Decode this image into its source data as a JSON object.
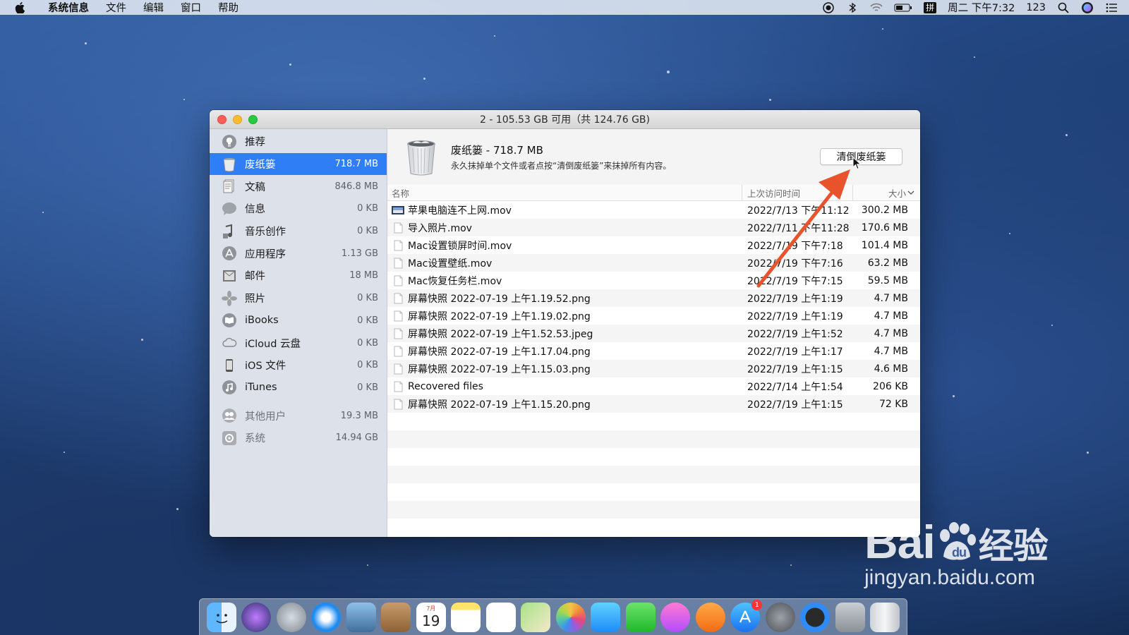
{
  "menubar": {
    "app_name": "系统信息",
    "menus": [
      "文件",
      "编辑",
      "窗口",
      "帮助"
    ],
    "clock": "周二 下午7:32",
    "ime_label": "拼",
    "user_num": "123"
  },
  "window": {
    "title": "2 - 105.53 GB 可用（共 124.76 GB)"
  },
  "sidebar": {
    "items": [
      {
        "label": "推荐",
        "size": "",
        "icon": "recommend-icon"
      },
      {
        "label": "废纸篓",
        "size": "718.7 MB",
        "icon": "trash-icon",
        "selected": true
      },
      {
        "label": "文稿",
        "size": "846.8 MB",
        "icon": "documents-icon"
      },
      {
        "label": "信息",
        "size": "0 KB",
        "icon": "messages-icon"
      },
      {
        "label": "音乐创作",
        "size": "0 KB",
        "icon": "music-creation-icon"
      },
      {
        "label": "应用程序",
        "size": "1.13 GB",
        "icon": "applications-icon"
      },
      {
        "label": "邮件",
        "size": "18 MB",
        "icon": "mail-icon"
      },
      {
        "label": "照片",
        "size": "0 KB",
        "icon": "photos-icon"
      },
      {
        "label": "iBooks",
        "size": "0 KB",
        "icon": "ibooks-icon"
      },
      {
        "label": "iCloud 云盘",
        "size": "0 KB",
        "icon": "icloud-icon"
      },
      {
        "label": "iOS 文件",
        "size": "0 KB",
        "icon": "ios-files-icon"
      },
      {
        "label": "iTunes",
        "size": "0 KB",
        "icon": "itunes-icon"
      }
    ],
    "other_items": [
      {
        "label": "其他用户",
        "size": "19.3 MB",
        "icon": "other-users-icon"
      },
      {
        "label": "系统",
        "size": "14.94 GB",
        "icon": "system-icon"
      }
    ]
  },
  "header": {
    "title": "废纸篓 - 718.7 MB",
    "description": "永久抹掉单个文件或者点按“清倒废纸篓”来抹掉所有内容。",
    "empty_button": "清倒废纸篓"
  },
  "table": {
    "columns": {
      "name": "名称",
      "date": "上次访问时间",
      "size": "大小"
    },
    "rows": [
      {
        "name": "苹果电脑连不上网.mov",
        "date": "2022/7/13 下午11:12",
        "size": "300.2 MB",
        "icon": "video-thumbnail-icon"
      },
      {
        "name": "导入照片.mov",
        "date": "2022/7/11 下午11:28",
        "size": "170.6 MB",
        "icon": "file-icon"
      },
      {
        "name": "Mac设置锁屏时间.mov",
        "date": "2022/7/19 下午7:18",
        "size": "101.4 MB",
        "icon": "file-icon"
      },
      {
        "name": "Mac设置壁纸.mov",
        "date": "2022/7/19 下午7:16",
        "size": "63.2 MB",
        "icon": "file-icon"
      },
      {
        "name": "Mac恢复任务栏.mov",
        "date": "2022/7/19 下午7:15",
        "size": "59.5 MB",
        "icon": "file-icon"
      },
      {
        "name": "屏幕快照 2022-07-19 上午1.19.52.png",
        "date": "2022/7/19 上午1:19",
        "size": "4.7 MB",
        "icon": "file-icon"
      },
      {
        "name": "屏幕快照 2022-07-19 上午1.19.02.png",
        "date": "2022/7/19 上午1:19",
        "size": "4.7 MB",
        "icon": "file-icon"
      },
      {
        "name": "屏幕快照 2022-07-19 上午1.52.53.jpeg",
        "date": "2022/7/19 上午1:52",
        "size": "4.7 MB",
        "icon": "file-icon"
      },
      {
        "name": "屏幕快照 2022-07-19 上午1.17.04.png",
        "date": "2022/7/19 上午1:17",
        "size": "4.7 MB",
        "icon": "file-icon"
      },
      {
        "name": "屏幕快照 2022-07-19 上午1.15.03.png",
        "date": "2022/7/19 上午1:15",
        "size": "4.6 MB",
        "icon": "file-icon"
      },
      {
        "name": "Recovered files",
        "date": "2022/7/14 上午1:54",
        "size": "206 KB",
        "icon": "file-icon"
      },
      {
        "name": "屏幕快照 2022-07-19 上午1.15.20.png",
        "date": "2022/7/19 上午1:15",
        "size": "72 KB",
        "icon": "file-icon"
      }
    ]
  },
  "dock": {
    "calendar_month": "7月",
    "calendar_day": "19",
    "appstore_badge": "1",
    "items": [
      "finder-icon",
      "siri-icon",
      "launchpad-icon",
      "safari-icon",
      "preview-icon",
      "contacts-icon",
      "calendar-icon",
      "notes-icon",
      "reminders-icon",
      "maps-icon",
      "photos-icon",
      "messages-icon",
      "facetime-icon",
      "itunes-icon",
      "ibooks-icon",
      "appstore-icon",
      "system-preferences-icon",
      "quicktime-icon",
      "automator-icon",
      "trash-icon"
    ]
  },
  "watermark": {
    "logo": "Bai",
    "logo_cn": "经验",
    "url": "jingyan.baidu.com"
  },
  "colors": {
    "selection": "#2f7ef6",
    "annotation_arrow": "#e8532c"
  }
}
